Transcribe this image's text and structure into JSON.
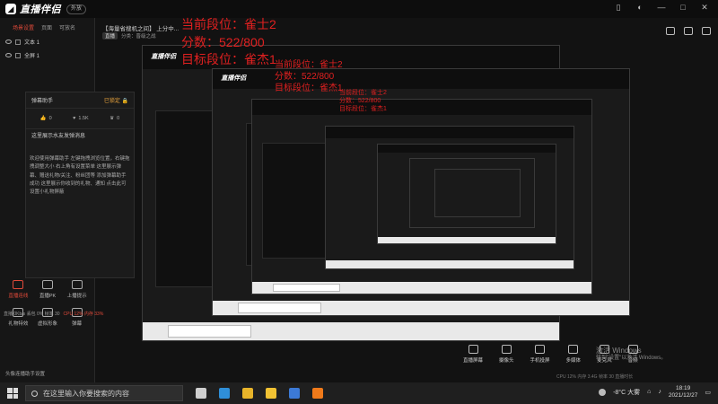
{
  "app": {
    "name": "直播伴侣",
    "badge": "外放"
  },
  "top_icons": [
    "phone-icon",
    "moon-icon",
    "minus-icon",
    "maximize-icon",
    "close-icon"
  ],
  "sidebar": {
    "tabs": [
      "场景设置",
      "页面",
      "可放名"
    ],
    "sources": [
      {
        "label": "文本 1"
      },
      {
        "label": "全屏 1"
      }
    ],
    "tools": [
      {
        "label": "直播连线",
        "icon": "link-icon",
        "red": true
      },
      {
        "label": "直播PK",
        "icon": "pk-icon",
        "red": false
      },
      {
        "label": "上播提示",
        "icon": "bell-icon",
        "red": false
      },
      {
        "label": "礼物特效",
        "icon": "gift-icon",
        "red": false
      },
      {
        "label": "虚拟形象",
        "icon": "avatar-icon",
        "red": false
      },
      {
        "label": "弹幕",
        "icon": "chat-icon",
        "red": false
      }
    ],
    "bottom_label": "头像连播助手设置"
  },
  "main": {
    "title": "【海量省搜机之间】 上分中...",
    "meta_tag": "直播",
    "meta_text": "分类：晋级之战"
  },
  "chat": {
    "title": "弹幕助手",
    "status": "已锁定",
    "stats": [
      {
        "icon": "like-icon",
        "value": "0"
      },
      {
        "icon": "heart-icon",
        "value": "1.5K"
      },
      {
        "icon": "crown-icon",
        "value": "0"
      }
    ],
    "welcome": "这里展示水友发弹消息",
    "hint": "欢迎使用弹幕助手 左键拖拽浏览位置，右键拖拽调整大小 右上角有设置菜单 这里展示弹幕、赠送礼物/关注、粉丝团等 添加弹幕助手成功 这里展示你收到的礼物、通知 点击此可设置小礼物屏蔽"
  },
  "stats_bar": {
    "text": "直播 0Kb/s 丢包 0% 帧率 30",
    "alert": "CPU 12% 内存 33%"
  },
  "overlay": {
    "rank": "当前段位：雀士2",
    "score": "分数：522/800",
    "target": "目标段位：雀杰1"
  },
  "controls": [
    {
      "label": "直播屏幕",
      "icon": "screen-icon"
    },
    {
      "label": "摄像头",
      "icon": "camera-icon"
    },
    {
      "label": "手机投屏",
      "icon": "phone-cast-icon"
    },
    {
      "label": "多媒体",
      "icon": "media-icon"
    },
    {
      "label": "麦克风",
      "icon": "mic-icon"
    },
    {
      "label": "音频",
      "icon": "speaker-icon"
    }
  ],
  "activation": {
    "line1": "激活 Windows",
    "line2": "转到\"设置\"以激活 Windows。"
  },
  "status_line": "CPU 12% 内存 3.4G 帧率 30 直播时长",
  "taskbar": {
    "search_placeholder": "在这里输入你要搜索的内容",
    "apps": [
      {
        "name": "task-view-icon",
        "color": "#cfcfcf"
      },
      {
        "name": "edge-icon",
        "color": "#2f8fd8"
      },
      {
        "name": "chrome-icon",
        "color": "#e8b42a"
      },
      {
        "name": "explorer-icon",
        "color": "#f1c233"
      },
      {
        "name": "mail-icon",
        "color": "#3c7ad6"
      },
      {
        "name": "zhibo-icon",
        "color": "#f07a1a"
      }
    ],
    "weather": "-8°C 大雾",
    "time": "18:19",
    "date": "2021/12/27"
  }
}
